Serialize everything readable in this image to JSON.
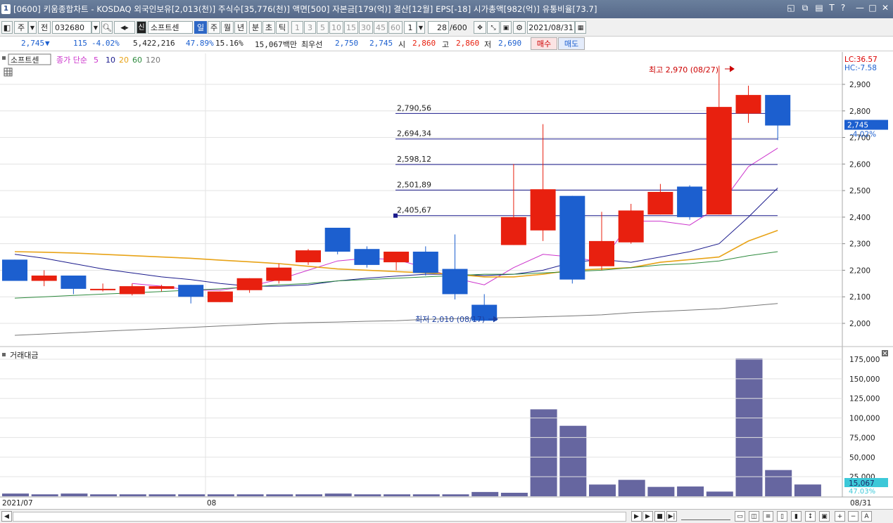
{
  "window": {
    "number": "1",
    "title": "[0600] 키움종합차트 - KOSDAQ 외국인보유[2,013(천)] 주식수[35,776(천)] 액면[500] 자본금[179(억)] 결산[12월] EPS[-18] 시가총액[982(억)] 유통비율[73.7]",
    "controls": [
      "◱",
      "⧉",
      "▤",
      "T",
      "?",
      "—",
      "□",
      "✕"
    ]
  },
  "toolbar": {
    "period_unit": "주",
    "all_label": "전",
    "code": "032680",
    "new_badge": "신",
    "stock_name": "소프트센",
    "periods": [
      "일",
      "주",
      "월",
      "년",
      "분",
      "초",
      "틱"
    ],
    "minutes": [
      "1",
      "3",
      "5",
      "10",
      "15",
      "30",
      "45",
      "60"
    ],
    "interval_value": "1",
    "count": "28",
    "count_total": "/600",
    "date": "2021/08/31"
  },
  "quote": {
    "price": "2,745",
    "arrow": "▼",
    "change": "115",
    "rate": "-4.02%",
    "volume": "5,422,216",
    "pct1": "47.89%",
    "pct2": "15.16%",
    "amount": "15,067백만",
    "best_label": "최우선",
    "best_ask": "2,750",
    "best_bid": "2,745",
    "open_label": "시",
    "open": "2,860",
    "high_label": "고",
    "high": "2,860",
    "low_label": "저",
    "low": "2,690",
    "buy_label": "매수",
    "sell_label": "매도"
  },
  "legend": {
    "stock": "소프트센",
    "ma_label": "종가 단순",
    "ma_periods": [
      "5",
      "10",
      "20",
      "60",
      "120"
    ],
    "volume_label": "거래대금"
  },
  "colors": {
    "up": "#e8200f",
    "down": "#1c5fcf",
    "ma5": "#cc33cc",
    "ma10": "#1a1a8c",
    "ma20": "#e8a317",
    "ma60": "#2e8b3e",
    "ma120": "#777777",
    "volume_bar": "#6666a0"
  },
  "chart_data": [
    {
      "type": "candlestick",
      "candles": [
        {
          "o": 2240,
          "h": 2240,
          "l": 2160,
          "c": 2160
        },
        {
          "o": 2160,
          "h": 2200,
          "l": 2140,
          "c": 2180
        },
        {
          "o": 2180,
          "h": 2180,
          "l": 2110,
          "c": 2130
        },
        {
          "o": 2130,
          "h": 2150,
          "l": 2120,
          "c": 2130
        },
        {
          "o": 2110,
          "h": 2150,
          "l": 2105,
          "c": 2140
        },
        {
          "o": 2130,
          "h": 2145,
          "l": 2120,
          "c": 2140
        },
        {
          "o": 2145,
          "h": 2145,
          "l": 2075,
          "c": 2100
        },
        {
          "o": 2080,
          "h": 2120,
          "l": 2080,
          "c": 2120
        },
        {
          "o": 2125,
          "h": 2170,
          "l": 2115,
          "c": 2170
        },
        {
          "o": 2160,
          "h": 2225,
          "l": 2150,
          "c": 2210
        },
        {
          "o": 2230,
          "h": 2280,
          "l": 2220,
          "c": 2275
        },
        {
          "o": 2360,
          "h": 2360,
          "l": 2260,
          "c": 2270
        },
        {
          "o": 2280,
          "h": 2290,
          "l": 2210,
          "c": 2220
        },
        {
          "o": 2230,
          "h": 2270,
          "l": 2200,
          "c": 2270
        },
        {
          "o": 2270,
          "h": 2290,
          "l": 2180,
          "c": 2190
        },
        {
          "o": 2205,
          "h": 2335,
          "l": 2090,
          "c": 2110
        },
        {
          "o": 2070,
          "h": 2110,
          "l": 2010,
          "c": 2010
        },
        {
          "o": 2295,
          "h": 2600,
          "l": 2295,
          "c": 2400
        },
        {
          "o": 2350,
          "h": 2750,
          "l": 2310,
          "c": 2505
        },
        {
          "o": 2480,
          "h": 2480,
          "l": 2150,
          "c": 2165
        },
        {
          "o": 2215,
          "h": 2420,
          "l": 2200,
          "c": 2310
        },
        {
          "o": 2305,
          "h": 2450,
          "l": 2300,
          "c": 2425
        },
        {
          "o": 2410,
          "h": 2525,
          "l": 2410,
          "c": 2495
        },
        {
          "o": 2515,
          "h": 2520,
          "l": 2390,
          "c": 2400
        },
        {
          "o": 2410,
          "h": 2970,
          "l": 2410,
          "c": 2815
        },
        {
          "o": 2790,
          "h": 2895,
          "l": 2755,
          "c": 2860
        },
        {
          "o": 2860,
          "h": 2860,
          "l": 2690,
          "c": 2745
        }
      ],
      "ma": {
        "5": [
          null,
          null,
          null,
          null,
          2150,
          2140,
          2125,
          2125,
          2140,
          2165,
          2200,
          2235,
          2245,
          2240,
          2210,
          2170,
          2145,
          2210,
          2260,
          2250,
          2230,
          2385,
          2385,
          2370,
          2440,
          2590,
          2660
        ],
        "10": [
          2260,
          2245,
          2225,
          2205,
          2190,
          2175,
          2165,
          2150,
          2140,
          2140,
          2145,
          2160,
          2170,
          2178,
          2185,
          2185,
          2180,
          2185,
          2200,
          2230,
          2240,
          2230,
          2250,
          2270,
          2300,
          2400,
          2510
        ],
        "20": [
          2270,
          2268,
          2265,
          2260,
          2255,
          2250,
          2245,
          2238,
          2232,
          2225,
          2215,
          2205,
          2200,
          2195,
          2190,
          2185,
          2175,
          2175,
          2185,
          2200,
          2205,
          2210,
          2230,
          2240,
          2250,
          2310,
          2350
        ],
        "60": [
          2095,
          2100,
          2105,
          2110,
          2115,
          2120,
          2125,
          2130,
          2137,
          2145,
          2150,
          2160,
          2165,
          2170,
          2175,
          2180,
          2185,
          2185,
          2190,
          2195,
          2200,
          2210,
          2220,
          2225,
          2235,
          2255,
          2270
        ],
        "120": [
          1955,
          1960,
          1965,
          1970,
          1975,
          1980,
          1985,
          1990,
          1995,
          2000,
          2003,
          2005,
          2008,
          2010,
          2015,
          2018,
          2020,
          2022,
          2025,
          2028,
          2032,
          2040,
          2045,
          2050,
          2055,
          2065,
          2075
        ]
      },
      "fib_levels": [
        {
          "label": "2,790,56",
          "value": 2790.56
        },
        {
          "label": "2,694,34",
          "value": 2694.34
        },
        {
          "label": "2,598,12",
          "value": 2598.12
        },
        {
          "label": "2,501,89",
          "value": 2501.89
        },
        {
          "label": "2,405,67",
          "value": 2405.67
        }
      ],
      "annotations": {
        "high": "최고 2,970 (08/27)",
        "low": "최저 2,010 (08/17)"
      },
      "yaxis": {
        "ticks": [
          2900,
          2800,
          2700,
          2600,
          2500,
          2400,
          2300,
          2200,
          2100,
          2000
        ],
        "labels": [
          "2,900",
          "2,800",
          "2,700",
          "2,600",
          "2,500",
          "2,400",
          "2,300",
          "2,200",
          "2,100",
          "2,000"
        ],
        "range": [
          1920,
          3020
        ]
      },
      "corner": {
        "lc": "LC:36.57",
        "hc": "HC:-7.58"
      },
      "current": {
        "price": "2,745",
        "rate": "-4.02%"
      },
      "xaxis": {
        "labels": [
          "2021/07",
          "08",
          "08/31"
        ]
      }
    },
    {
      "type": "bar",
      "title": "거래대금",
      "values": [
        3500,
        2500,
        3500,
        2500,
        2500,
        2500,
        2500,
        2500,
        2500,
        2500,
        2500,
        3500,
        2500,
        2500,
        2500,
        2500,
        5500,
        4500,
        111000,
        90000,
        15000,
        21000,
        12000,
        12500,
        6000,
        176000,
        33500,
        15067
      ],
      "yaxis": {
        "ticks": [
          175000,
          150000,
          125000,
          100000,
          75000,
          50000,
          25000
        ],
        "labels": [
          "175,000",
          "150,000",
          "125,000",
          "100,000",
          "75,000",
          "50,000",
          "25,000"
        ],
        "range": [
          0,
          185000
        ]
      },
      "current": {
        "value": "15,067",
        "rate": "47.03%"
      }
    }
  ]
}
